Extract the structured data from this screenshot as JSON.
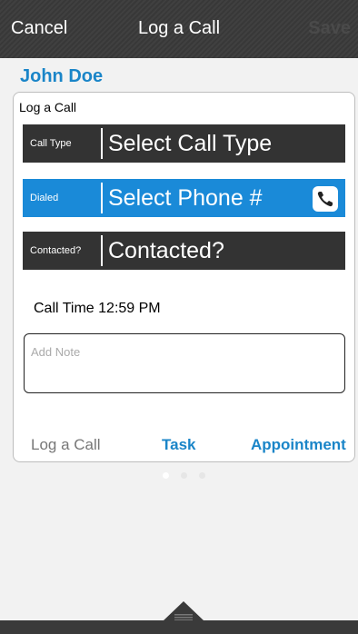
{
  "navbar": {
    "cancel": "Cancel",
    "title": "Log a Call",
    "save": "Save"
  },
  "contact": {
    "name": "John Doe"
  },
  "card": {
    "title": "Log a Call",
    "fields": [
      {
        "label": "Call Type",
        "value": "Select Call Type"
      },
      {
        "label": "Dialed",
        "value": "Select Phone #",
        "icon": "phone-icon"
      },
      {
        "label": "Contacted?",
        "value": "Contacted?"
      }
    ],
    "call_time": {
      "label": "Call Time",
      "value": "12:59 PM"
    },
    "note": {
      "placeholder": "Add Note"
    },
    "tabs": [
      {
        "label": "Log a Call"
      },
      {
        "label": "Task"
      },
      {
        "label": "Appointment"
      }
    ]
  },
  "pager": {
    "pages": 3,
    "current": 1
  },
  "colors": {
    "accent": "#1a85c8",
    "selected_row": "#1a8ad8",
    "navbar": "#3a3a3a",
    "dark_row": "#333333"
  }
}
